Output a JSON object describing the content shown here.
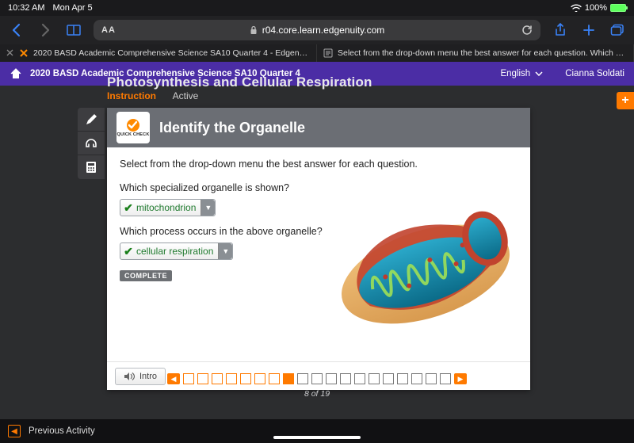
{
  "statusbar": {
    "time": "10:32 AM",
    "date": "Mon Apr 5",
    "battery": "100%"
  },
  "safari": {
    "url": "r04.core.learn.edgenuity.com",
    "aa": "AA"
  },
  "tabs": {
    "t1": "2020 BASD Academic Comprehensive Science SA10 Quarter 4 - Edgenuity.com",
    "t2": "Select from the drop-down menu the best answer for each question. Which specialized..."
  },
  "coursebar": {
    "title": "2020 BASD Academic Comprehensive Science SA10 Quarter 4",
    "language": "English",
    "user": "Cianna Soldati"
  },
  "lesson": {
    "title": "Photosynthesis and Cellular Respiration",
    "instruction": "Instruction",
    "active": "Active"
  },
  "card": {
    "quickcheck": "QUICK CHECK",
    "title": "Identify the Organelle",
    "prompt": "Select from the drop-down menu the best answer for each question.",
    "q1": "Which specialized organelle is shown?",
    "a1": "mitochondrion",
    "q2": "Which process occurs in the above organelle?",
    "a2": "cellular respiration",
    "complete": "COMPLETE",
    "intro": "Intro"
  },
  "pager": {
    "text": "8 of 19",
    "current": 8,
    "total": 19
  },
  "bottom": {
    "prev": "Previous Activity"
  }
}
